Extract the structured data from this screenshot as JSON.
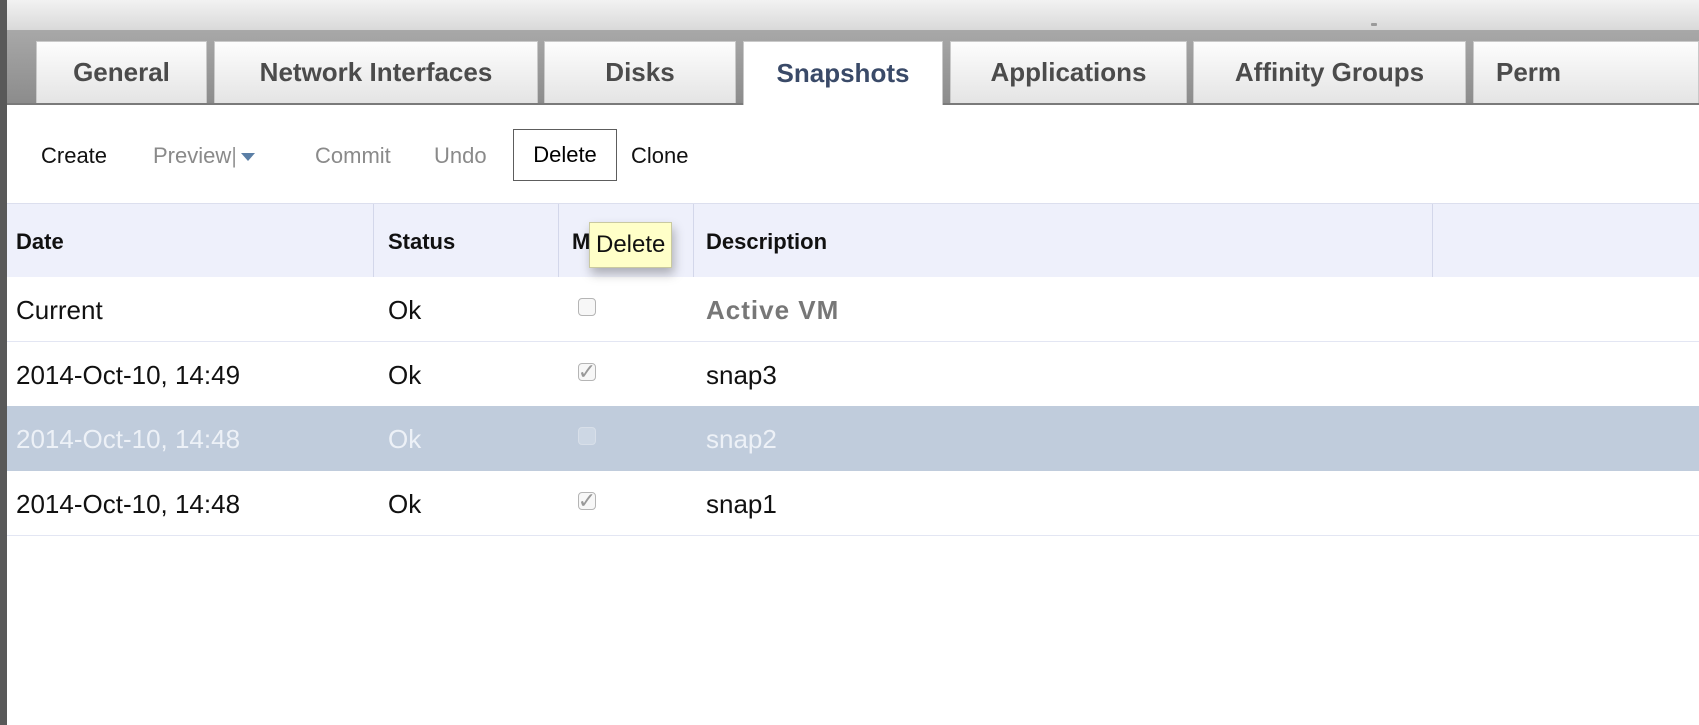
{
  "tabs": [
    {
      "label": "General",
      "active": false
    },
    {
      "label": "Network Interfaces",
      "active": false
    },
    {
      "label": "Disks",
      "active": false
    },
    {
      "label": "Snapshots",
      "active": true
    },
    {
      "label": "Applications",
      "active": false
    },
    {
      "label": "Affinity Groups",
      "active": false
    },
    {
      "label": "Perm",
      "active": false
    }
  ],
  "toolbar": {
    "create_label": "Create",
    "preview_label": "Preview",
    "preview_separator": "|",
    "commit_label": "Commit",
    "undo_label": "Undo",
    "delete_label": "Delete",
    "clone_label": "Clone"
  },
  "grid": {
    "columns": [
      "Date",
      "Status",
      "M",
      "Description"
    ],
    "rows": [
      {
        "date": "Current",
        "status": "Ok",
        "memory": false,
        "description": "Active VM",
        "selected": false
      },
      {
        "date": "2014-Oct-10, 14:49",
        "status": "Ok",
        "memory": true,
        "description": "snap3",
        "selected": false
      },
      {
        "date": "2014-Oct-10, 14:48",
        "status": "Ok",
        "memory": false,
        "description": "snap2",
        "selected": true
      },
      {
        "date": "2014-Oct-10, 14:48",
        "status": "Ok",
        "memory": true,
        "description": "snap1",
        "selected": false
      }
    ]
  },
  "tooltip": {
    "text": "Delete"
  },
  "icons": {
    "checked": "checkmark-icon",
    "dropdown": "chevron-down-icon"
  },
  "colors": {
    "active_tab_text": "#3a4a68",
    "header_bg": "#eef0fb",
    "selected_row_bg": "#c0ccdc",
    "tooltip_bg": "#ffffc8"
  }
}
